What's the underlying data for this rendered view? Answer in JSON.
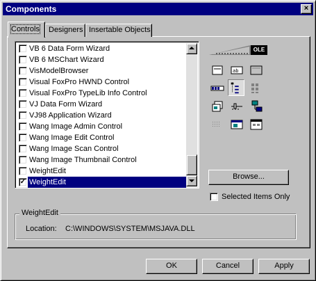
{
  "window": {
    "title": "Components",
    "close_glyph": "×"
  },
  "tabs": [
    {
      "label": "Controls"
    },
    {
      "label": "Designers"
    },
    {
      "label": "Insertable Objects"
    }
  ],
  "list": {
    "items": [
      {
        "label": "VB 6 Data Form Wizard",
        "checked": false
      },
      {
        "label": "VB 6 MSChart Wizard",
        "checked": false
      },
      {
        "label": "VisModelBrowser",
        "checked": false
      },
      {
        "label": "Visual FoxPro HWND Control",
        "checked": false
      },
      {
        "label": "Visual FoxPro TypeLib Info Control",
        "checked": false
      },
      {
        "label": "VJ Data Form Wizard",
        "checked": false
      },
      {
        "label": "VJ98 Application Wizard",
        "checked": false
      },
      {
        "label": "Wang Image Admin Control",
        "checked": false
      },
      {
        "label": "Wang Image Edit Control",
        "checked": false
      },
      {
        "label": "Wang Image Scan Control",
        "checked": false
      },
      {
        "label": "Wang Image Thumbnail Control",
        "checked": false
      },
      {
        "label": "WeightEdit",
        "checked": false
      },
      {
        "label": "WeightEdit",
        "checked": true,
        "selected": true
      }
    ],
    "check_glyph": "✓"
  },
  "toolbox": {
    "ole_label": "OLE"
  },
  "browse_label": "Browse...",
  "selected_only_label": "Selected Items Only",
  "details": {
    "group_title": "WeightEdit",
    "location_label": "Location:",
    "location_value": "C:\\WINDOWS\\SYSTEM\\MSJAVA.DLL"
  },
  "buttons": {
    "ok": "OK",
    "cancel": "Cancel",
    "apply": "Apply"
  },
  "colors": {
    "selection": "#000080",
    "title_bar": "#000080",
    "face": "#c0c0c0"
  }
}
